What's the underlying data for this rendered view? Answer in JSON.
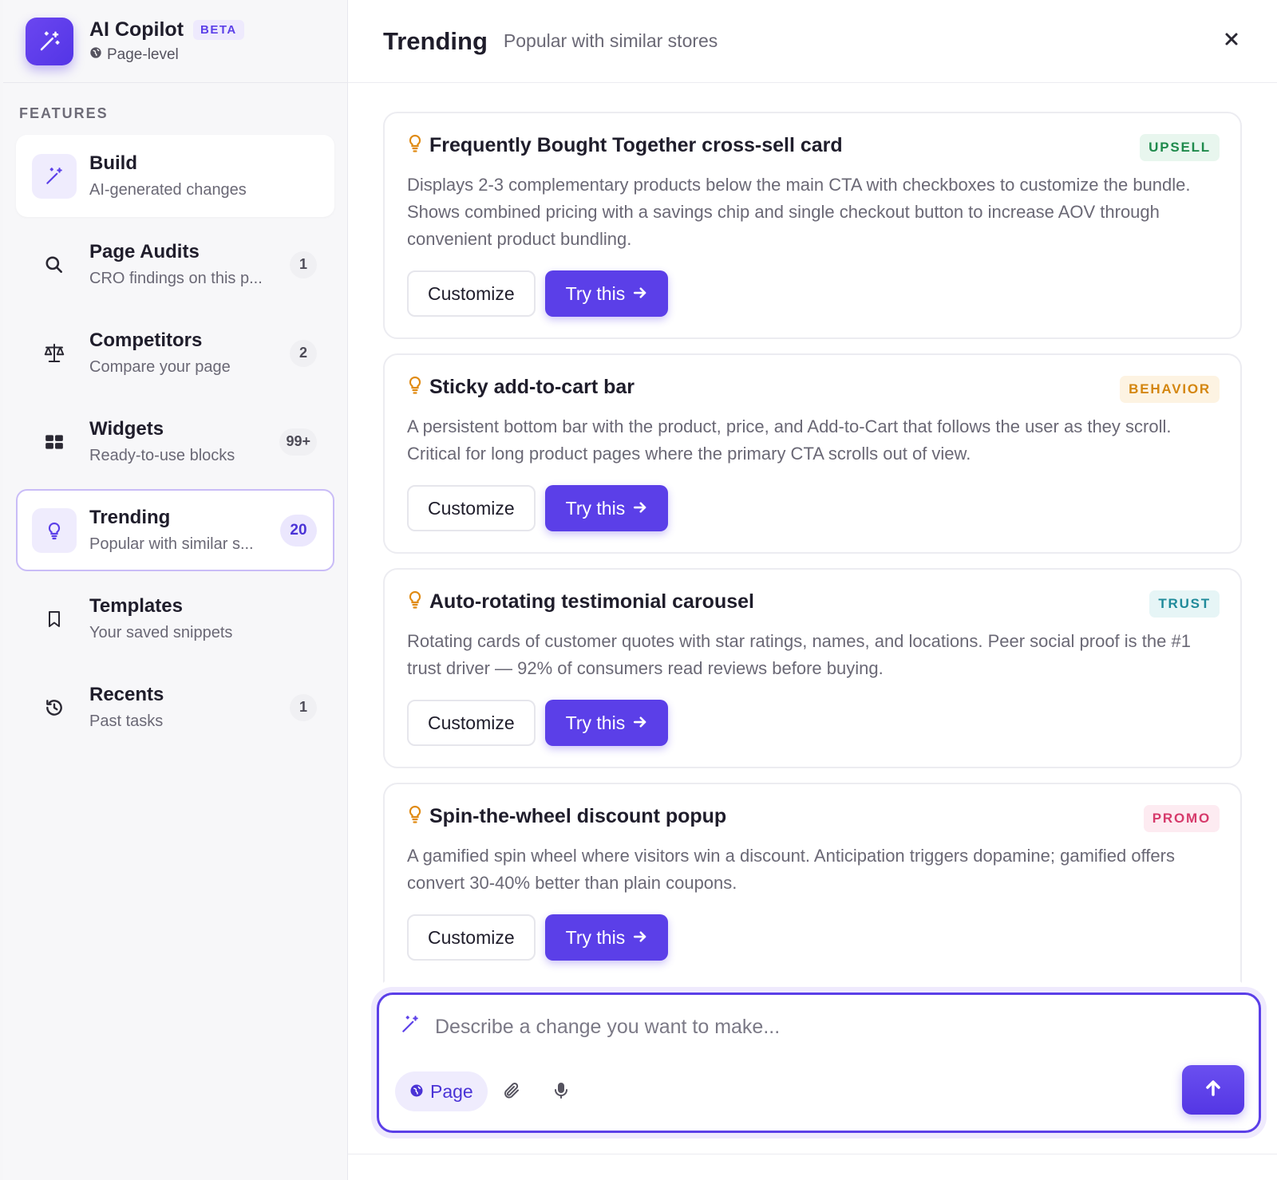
{
  "brand": {
    "title": "AI Copilot",
    "badge": "BETA",
    "subtitle": "Page-level"
  },
  "sidebar": {
    "section_label": "FEATURES",
    "items": [
      {
        "label": "Build",
        "sub": "AI-generated changes",
        "count": "",
        "icon": "magic-wand-icon"
      },
      {
        "label": "Page Audits",
        "sub": "CRO findings on this p...",
        "count": "1",
        "icon": "search-icon"
      },
      {
        "label": "Competitors",
        "sub": "Compare your page",
        "count": "2",
        "icon": "scale-icon"
      },
      {
        "label": "Widgets",
        "sub": "Ready-to-use blocks",
        "count": "99+",
        "icon": "grid-icon"
      },
      {
        "label": "Trending",
        "sub": "Popular with similar s...",
        "count": "20",
        "icon": "lightbulb-icon"
      },
      {
        "label": "Templates",
        "sub": "Your saved snippets",
        "count": "",
        "icon": "bookmark-icon"
      },
      {
        "label": "Recents",
        "sub": "Past tasks",
        "count": "1",
        "icon": "history-icon"
      }
    ]
  },
  "header": {
    "title": "Trending",
    "subtitle": "Popular with similar stores",
    "close_icon": "close-icon"
  },
  "cards": [
    {
      "title": "Frequently Bought Together cross-sell card",
      "tag": "UPSELL",
      "description": "Displays 2-3 complementary products below the main CTA with checkboxes to customize the bundle. Shows combined pricing with a savings chip and single checkout button to increase AOV through convenient product bundling.",
      "customize_label": "Customize",
      "try_label": "Try this"
    },
    {
      "title": "Sticky add-to-cart bar",
      "tag": "BEHAVIOR",
      "description": "A persistent bottom bar with the product, price, and Add-to-Cart that follows the user as they scroll. Critical for long product pages where the primary CTA scrolls out of view.",
      "customize_label": "Customize",
      "try_label": "Try this"
    },
    {
      "title": "Auto-rotating testimonial carousel",
      "tag": "TRUST",
      "description": "Rotating cards of customer quotes with star ratings, names, and locations. Peer social proof is the #1 trust driver — 92% of consumers read reviews before buying.",
      "customize_label": "Customize",
      "try_label": "Try this"
    },
    {
      "title": "Spin-the-wheel discount popup",
      "tag": "PROMO",
      "description": "A gamified spin wheel where visitors win a discount. Anticipation triggers dopamine; gamified offers convert 30-40% better than plain coupons.",
      "customize_label": "Customize",
      "try_label": "Try this"
    }
  ],
  "composer": {
    "placeholder": "Describe a change you want to make...",
    "scope_label": "Page"
  },
  "colors": {
    "accent": "#5b3fe8",
    "upsell_fg": "#1f8a4c",
    "upsell_bg": "#e8f6ee",
    "behavior_fg": "#d4860f",
    "behavior_bg": "#fdf3e2",
    "trust_fg": "#1f8a9a",
    "trust_bg": "#e6f5f6",
    "promo_fg": "#d63a6b",
    "promo_bg": "#fdebf1",
    "bulb": "#e08a12"
  }
}
